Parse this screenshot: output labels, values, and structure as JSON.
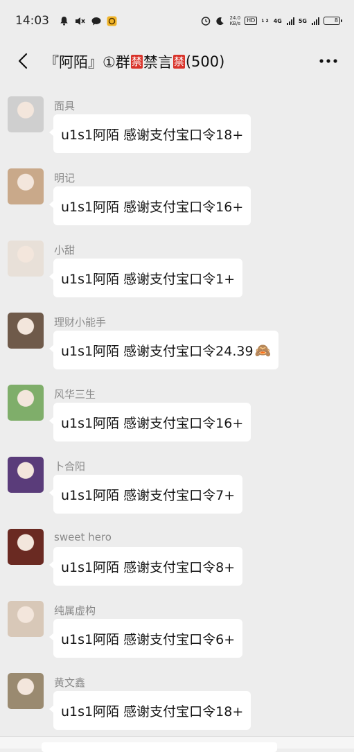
{
  "status_bar": {
    "time": "14:03",
    "net_speed_value": "24.0",
    "net_speed_unit": "KB/s",
    "hd_label": "HD",
    "hd_sub": "1 2",
    "net_4g": "4G",
    "net_5g": "5G",
    "battery": "8"
  },
  "header": {
    "title_part1": "『阿陌』①群",
    "ban_badge": "禁",
    "title_part2": "禁言",
    "title_count": "(500)"
  },
  "messages": [
    {
      "sender": "面具",
      "text": "u1s1阿陌 感谢支付宝口令18+",
      "avatar_color": "#cfcfcf"
    },
    {
      "sender": "明记",
      "text": "u1s1阿陌 感谢支付宝口令16+",
      "avatar_color": "#c9a98a"
    },
    {
      "sender": "小甜",
      "text": "u1s1阿陌 感谢支付宝口令1+",
      "avatar_color": "#e8e0d8"
    },
    {
      "sender": "理财小能手",
      "text": "u1s1阿陌 感谢支付宝口令24.39",
      "emoji": "🙈",
      "avatar_color": "#6f5a4a"
    },
    {
      "sender": "风华三生",
      "text": "u1s1阿陌 感谢支付宝口令16+",
      "avatar_color": "#7fae6a"
    },
    {
      "sender": "卜合阳",
      "text": "u1s1阿陌 感谢支付宝口令7+",
      "avatar_color": "#5a3c7a"
    },
    {
      "sender": "sweet hero",
      "text": "u1s1阿陌 感谢支付宝口令8+",
      "avatar_color": "#6a2a22"
    },
    {
      "sender": "纯属虚构",
      "text": "u1s1阿陌 感谢支付宝口令6+",
      "avatar_color": "#d8c8b8"
    },
    {
      "sender": "黄文鑫",
      "text": "u1s1阿陌 感谢支付宝口令18+",
      "avatar_color": "#9a8a70"
    }
  ]
}
